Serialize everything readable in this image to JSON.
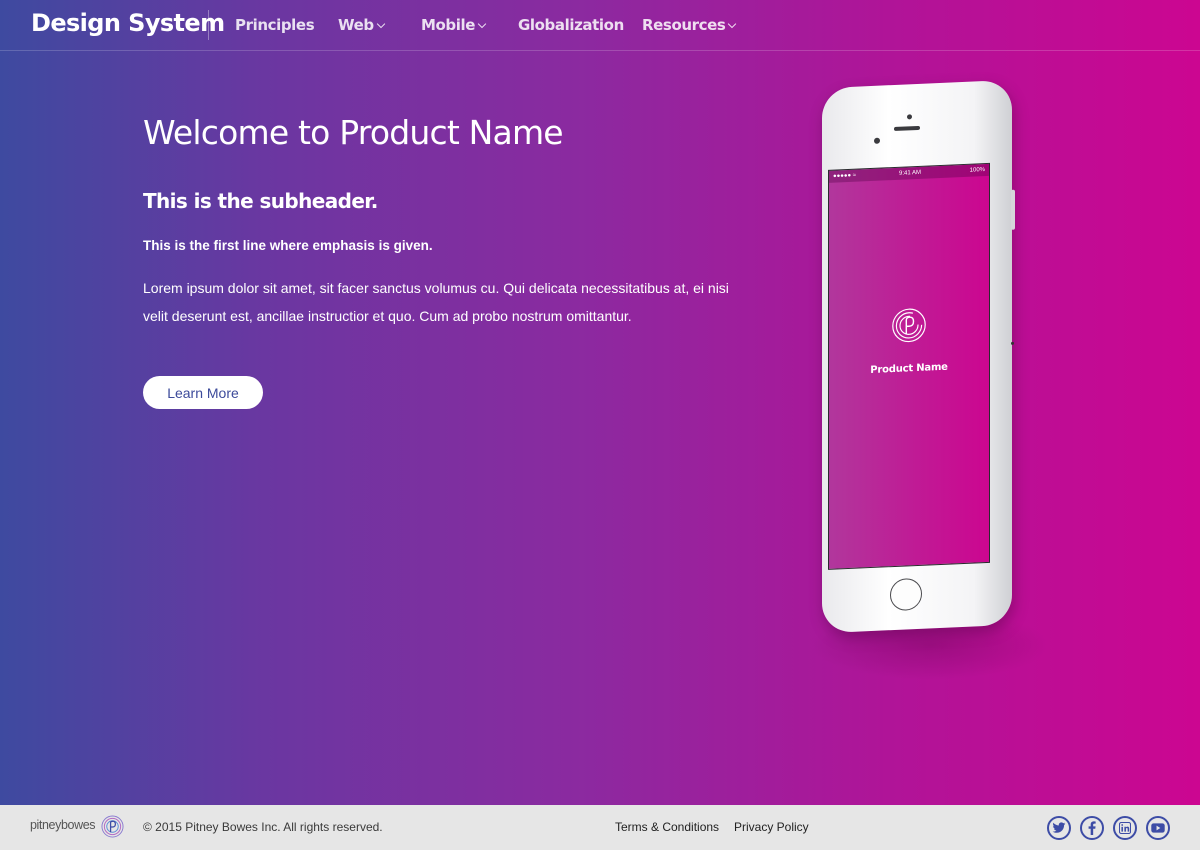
{
  "nav": {
    "brand": "Design System",
    "items": [
      {
        "label": "Principles",
        "has_caret": false
      },
      {
        "label": "Web",
        "has_caret": true
      },
      {
        "label": "Mobile",
        "has_caret": true
      },
      {
        "label": "Globalization",
        "has_caret": false
      },
      {
        "label": "Resources",
        "has_caret": true
      }
    ]
  },
  "hero": {
    "title": "Welcome to Product Name",
    "subheader": "This is the subheader.",
    "emphasis": "This is the first line where emphasis is given.",
    "body": "Lorem ipsum dolor sit amet, sit facer sanctus volumus cu. Qui delicata necessitatibus at, ei nisi velit deserunt est, ancillae instructior et quo. Cum ad probo nostrum omittantur.",
    "cta_label": "Learn More",
    "gradient_start": "#3e4aa0",
    "gradient_end": "#cc0691"
  },
  "phone": {
    "status_signal": "●●●●● ≈",
    "status_time": "9:41 AM",
    "status_battery": "100%",
    "app_name": "Product Name"
  },
  "footer": {
    "logo_word_1": "pitney",
    "logo_word_2": "bowes",
    "copyright": "© 2015 Pitney Bowes Inc. All rights reserved.",
    "links": [
      "Terms & Conditions",
      "Privacy Policy"
    ],
    "social_icons": [
      "twitter-icon",
      "facebook-icon",
      "linkedin-icon",
      "youtube-icon"
    ],
    "accent": "#3d4ca6"
  }
}
